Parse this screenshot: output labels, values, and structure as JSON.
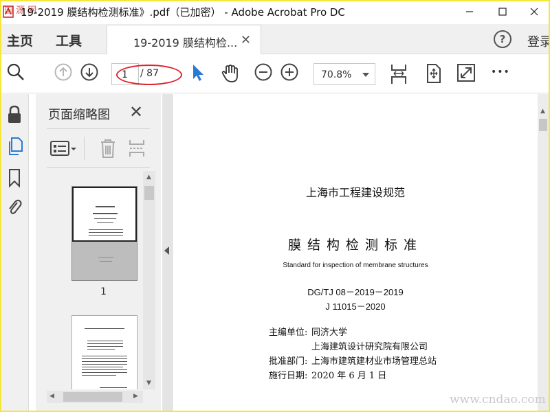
{
  "window": {
    "title": "19-2019 膜结构检测标准》.pdf（已加密） - Adobe Acrobat Pro DC",
    "minimize": "–",
    "maximize": "☐",
    "close": "✕"
  },
  "watermark_top": "国 源 网",
  "nav": {
    "home": "主页",
    "tools": "工具",
    "doc_tab": "19-2019 膜结构检...",
    "doc_tab_close": "✕",
    "help": "?",
    "login": "登录"
  },
  "toolbar": {
    "page_current": "1",
    "page_total": "/ 87",
    "zoom": "70.8%",
    "more": "•••"
  },
  "panel": {
    "title": "页面缩略图",
    "close": "✕",
    "thumb1_label": "1"
  },
  "document": {
    "series": "上海市工程建设规范",
    "title": "膜结构检测标准",
    "english": "Standard for inspection of membrane structures",
    "code1": "DG/TJ 08－2019－2019",
    "code2": "J 11015－2020",
    "editor_label": "主编单位:",
    "editor1": "同济大学",
    "editor2": "上海建筑设计研究院有限公司",
    "approver_label": "批准部门:",
    "approver": "上海市建筑建材业市场管理总站",
    "date_label": "施行日期:",
    "date": "2020 年 6 月 1 日"
  },
  "footer_watermark": "www.cndao.com",
  "colors": {
    "frame": "#f5e63a",
    "annotation": "#e0202a",
    "select_tool": "#2a7ad5"
  }
}
